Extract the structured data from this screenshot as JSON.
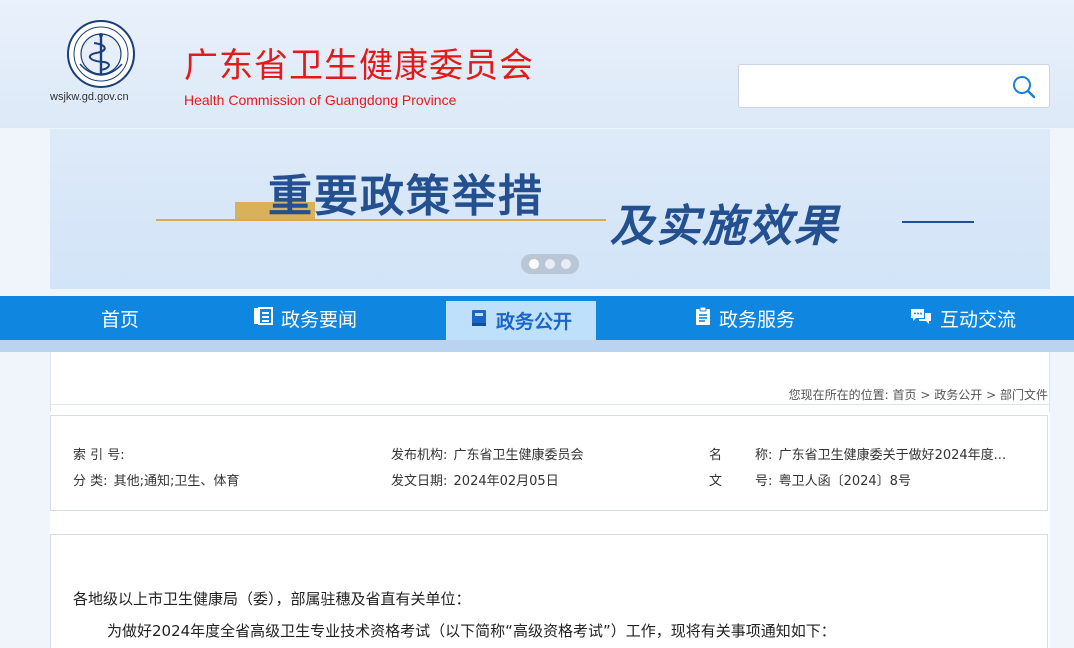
{
  "header": {
    "domain_text": "wsjkw.gd.gov.cn",
    "title": "广东省卫生健康委员会",
    "subtitle": "Health Commission of Guangdong Province",
    "emblem_icon": "health-emblem-icon",
    "search": {
      "value": "",
      "placeholder": "",
      "icon": "search-icon"
    }
  },
  "banner": {
    "text_line1": "重要政策举措",
    "text_line2": "及实施效果",
    "dots": 3,
    "active_dot": 1
  },
  "nav": {
    "items": [
      {
        "label": "首页",
        "icon": ""
      },
      {
        "label": "政务要闻",
        "icon": "news-icon"
      },
      {
        "label": "政务公开",
        "icon": "book-icon",
        "active": true
      },
      {
        "label": "政务服务",
        "icon": "clipboard-icon"
      },
      {
        "label": "互动交流",
        "icon": "chat-icon"
      }
    ]
  },
  "breadcrumb": {
    "prefix": "您现在所在的位置:",
    "items": [
      "首页",
      "政务公开",
      "部门文件"
    ],
    "separator": " > "
  },
  "meta": {
    "index_label": "索 引 号:",
    "index_value": "",
    "category_label": "分 类:",
    "category_value": "其他;通知;卫生、体育",
    "publisher_label": "发布机构:",
    "publisher_value": "广东省卫生健康委员会",
    "date_label": "发文日期:",
    "date_value": "2024年02月05日",
    "name_label": "名        称:",
    "name_value": "广东省卫生健康委关于做好2024年度...",
    "doc_no_label": "文        号:",
    "doc_no_value": "粤卫人函〔2024〕8号"
  },
  "document": {
    "salutation": "各地级以上市卫生健康局（委），部属驻穗及省直有关单位：",
    "paragraph1": "为做好2024年度全省高级卫生专业技术资格考试（以下简称“高级资格考试”）工作，现将有关事项通知如下："
  },
  "colors": {
    "brand_red": "#e21a1a",
    "nav_blue": "#0f86e0",
    "nav_active_bg": "#bfe0fa",
    "banner_text": "#24508f",
    "banner_gold": "#d9a94a"
  }
}
